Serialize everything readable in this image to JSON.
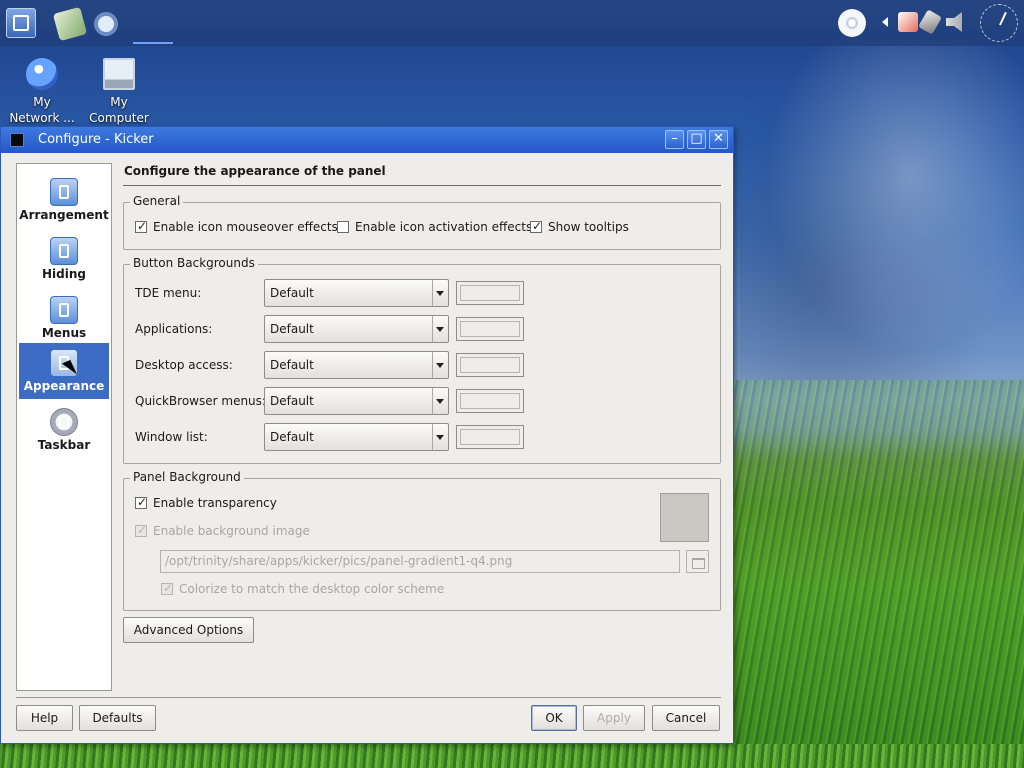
{
  "desktop": {
    "icons": [
      {
        "label_line1": "My",
        "label_line2": "Network ..."
      },
      {
        "label_line1": "My",
        "label_line2": "Computer"
      }
    ]
  },
  "window": {
    "title": "Configure - Kicker",
    "buttons": {
      "minimize": "–",
      "maximize": "□",
      "close": "✕"
    }
  },
  "sidebar": {
    "items": [
      {
        "label": "Arrangement",
        "icon": "arrangement-icon"
      },
      {
        "label": "Hiding",
        "icon": "hiding-icon"
      },
      {
        "label": "Menus",
        "icon": "menus-icon"
      },
      {
        "label": "Appearance",
        "icon": "appearance-icon",
        "selected": true
      },
      {
        "label": "Taskbar",
        "icon": "taskbar-icon"
      }
    ]
  },
  "content": {
    "heading": "Configure the appearance of the panel",
    "general": {
      "title": "General",
      "mouseover": {
        "label": "Enable icon mouseover effects",
        "checked": true
      },
      "activation": {
        "label": "Enable icon activation effects",
        "checked": false
      },
      "tooltips": {
        "label": "Show tooltips",
        "checked": true
      }
    },
    "button_backgrounds": {
      "title": "Button Backgrounds",
      "rows": [
        {
          "label": "TDE menu:",
          "value": "Default"
        },
        {
          "label": "Applications:",
          "value": "Default"
        },
        {
          "label": "Desktop access:",
          "value": "Default"
        },
        {
          "label": "QuickBrowser menus:",
          "value": "Default"
        },
        {
          "label": "Window list:",
          "value": "Default"
        }
      ]
    },
    "panel_background": {
      "title": "Panel Background",
      "transparency": {
        "label": "Enable transparency",
        "checked": true
      },
      "bg_image": {
        "label": "Enable background image",
        "checked": true,
        "disabled": true
      },
      "path": "/opt/trinity/share/apps/kicker/pics/panel-gradient1-q4.png",
      "colorize": {
        "label": "Colorize to match the desktop color scheme",
        "checked": true,
        "disabled": true
      }
    },
    "advanced_button": "Advanced Options"
  },
  "footer": {
    "help": "Help",
    "defaults": "Defaults",
    "ok": "OK",
    "apply": "Apply",
    "cancel": "Cancel"
  }
}
